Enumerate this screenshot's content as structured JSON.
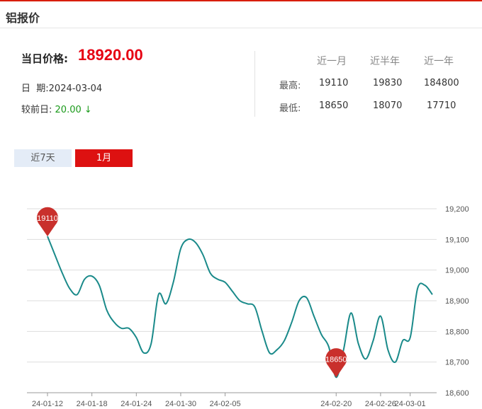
{
  "header": {
    "title": "铝报价"
  },
  "summary": {
    "price_label": "当日价格:",
    "price_value": "18920.00",
    "date_label": "日  期:",
    "date_value": "2024-03-04",
    "change_label": "较前日:",
    "change_value": "20.00",
    "change_arrow": "↓"
  },
  "stats": {
    "headers": [
      "近一月",
      "近半年",
      "近一年"
    ],
    "rows": [
      {
        "label": "最高:",
        "values": [
          "19110",
          "19830",
          "184800"
        ]
      },
      {
        "label": "最低:",
        "values": [
          "18650",
          "18070",
          "17710"
        ]
      }
    ]
  },
  "tabs": [
    {
      "label": "近7天",
      "active": false
    },
    {
      "label": "1月",
      "active": true
    }
  ],
  "colors": {
    "accent": "#e60012",
    "line": "#1a8a8a",
    "down": "#1a9a1a",
    "marker": "#c9302c"
  },
  "chart_data": {
    "type": "line",
    "x": [
      "24-01-12",
      "24-01-13",
      "24-01-14",
      "24-01-15",
      "24-01-16",
      "24-01-17",
      "24-01-18",
      "24-01-19",
      "24-01-20",
      "24-01-21",
      "24-01-22",
      "24-01-23",
      "24-01-24",
      "24-01-25",
      "24-01-26",
      "24-01-27",
      "24-01-28",
      "24-01-29",
      "24-01-30",
      "24-01-31",
      "24-02-01",
      "24-02-02",
      "24-02-03",
      "24-02-04",
      "24-02-05",
      "24-02-06",
      "24-02-07",
      "24-02-08",
      "24-02-09",
      "24-02-10",
      "24-02-11",
      "24-02-12",
      "24-02-13",
      "24-02-14",
      "24-02-15",
      "24-02-16",
      "24-02-17",
      "24-02-18",
      "24-02-19",
      "24-02-20",
      "24-02-21",
      "24-02-22",
      "24-02-23",
      "24-02-24",
      "24-02-25",
      "24-02-26",
      "24-02-27",
      "24-02-28",
      "24-02-29",
      "24-03-01",
      "24-03-02",
      "24-03-03",
      "24-03-04"
    ],
    "series": [
      {
        "values": [
          19110,
          19050,
          18990,
          18940,
          18920,
          18970,
          18980,
          18950,
          18870,
          18830,
          18810,
          18810,
          18780,
          18730,
          18760,
          18920,
          18890,
          18960,
          19070,
          19100,
          19090,
          19050,
          18990,
          18970,
          18960,
          18930,
          18900,
          18890,
          18880,
          18800,
          18730,
          18740,
          18770,
          18830,
          18900,
          18910,
          18850,
          18790,
          18750,
          18650,
          18740,
          18860,
          18760,
          18710,
          18770,
          18850,
          18740,
          18700,
          18770,
          18780,
          18940,
          18950,
          18920
        ]
      }
    ],
    "xticks": [
      "24-01-12",
      "24-01-18",
      "24-01-24",
      "24-01-30",
      "24-02-05",
      "24-02-20",
      "24-02-26",
      "24-03-01"
    ],
    "yticks": [
      "18,600",
      "18,700",
      "18,800",
      "18,900",
      "19,000",
      "19,100",
      "19,200"
    ],
    "ylim": [
      18600,
      19200
    ],
    "grid": true,
    "annotations": [
      {
        "text": "19110"
      },
      {
        "text": "18650"
      }
    ]
  }
}
